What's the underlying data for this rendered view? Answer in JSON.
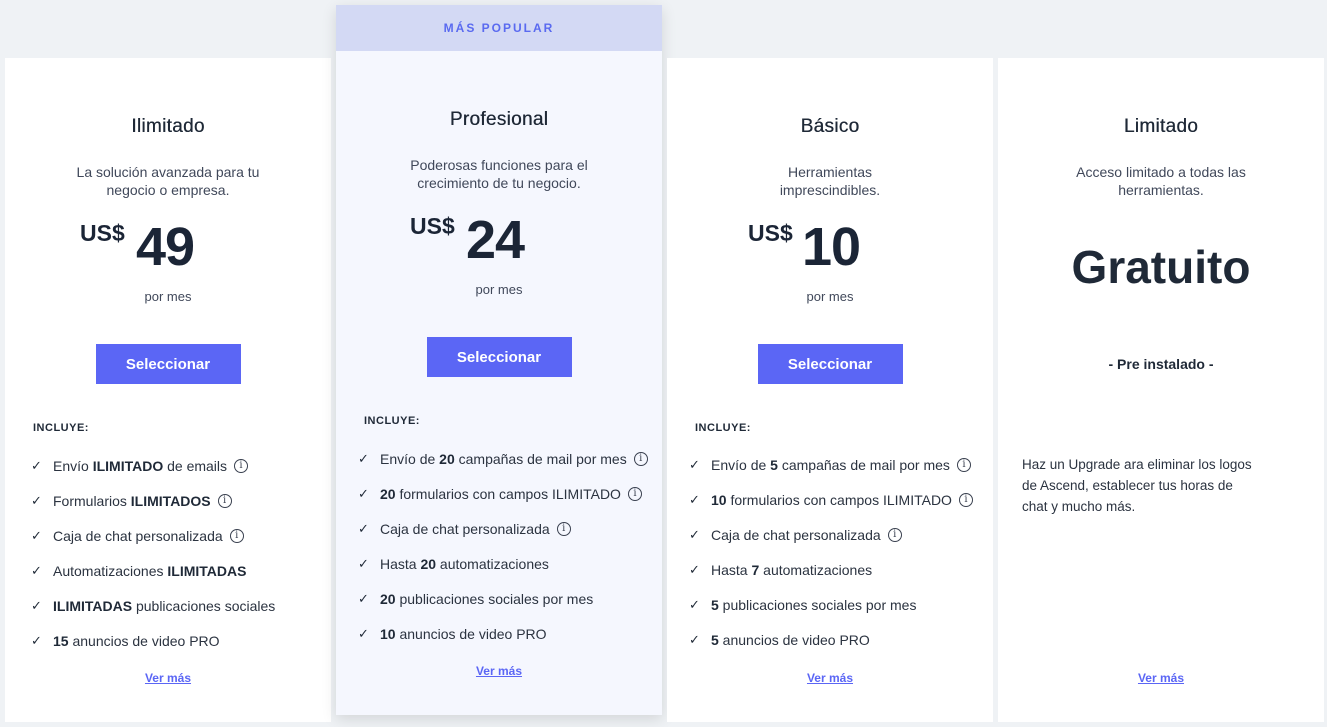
{
  "popular_banner": "MÁS POPULAR",
  "plans": [
    {
      "name": "Ilimitado",
      "description": "La solución avanzada para tu negocio o empresa.",
      "currency": "US$",
      "amount": "49",
      "period": "por mes",
      "button": "Seleccionar",
      "includes_label": "INCLUYE:",
      "features": [
        {
          "pre": "Envío ",
          "bold": "ILIMITADO",
          "post": " de emails",
          "info": true
        },
        {
          "pre": "Formularios ",
          "bold": "ILIMITADOS",
          "post": "",
          "info": true
        },
        {
          "pre": "Caja de chat personalizada",
          "bold": "",
          "post": "",
          "info": true
        },
        {
          "pre": "Automatizaciones ",
          "bold": "ILIMITADAS",
          "post": "",
          "info": false
        },
        {
          "pre": "",
          "bold": "ILIMITADAS",
          "post": " publicaciones sociales",
          "info": false
        },
        {
          "pre": "",
          "bold": "15",
          "post": " anuncios de video PRO",
          "info": false
        }
      ],
      "more": "Ver más"
    },
    {
      "name": "Profesional",
      "description": "Poderosas funciones para el crecimiento de tu negocio.",
      "currency": "US$",
      "amount": "24",
      "period": "por mes",
      "button": "Seleccionar",
      "includes_label": "INCLUYE:",
      "features": [
        {
          "pre": "Envío de ",
          "bold": "20",
          "post": " campañas de mail por mes",
          "info": true
        },
        {
          "pre": "",
          "bold": "20",
          "post": " formularios con campos ILIMITADO",
          "info": true
        },
        {
          "pre": "Caja de chat personalizada",
          "bold": "",
          "post": "",
          "info": true
        },
        {
          "pre": "Hasta ",
          "bold": "20",
          "post": " automatizaciones",
          "info": false
        },
        {
          "pre": "",
          "bold": "20",
          "post": " publicaciones sociales por mes",
          "info": false
        },
        {
          "pre": "",
          "bold": "10",
          "post": " anuncios de video PRO",
          "info": false
        }
      ],
      "more": "Ver más"
    },
    {
      "name": "Básico",
      "description": "Herramientas imprescindibles.",
      "currency": "US$",
      "amount": "10",
      "period": "por mes",
      "button": "Seleccionar",
      "includes_label": "INCLUYE:",
      "features": [
        {
          "pre": "Envío de ",
          "bold": "5",
          "post": " campañas de mail por mes",
          "info": true
        },
        {
          "pre": "",
          "bold": "10",
          "post": " formularios con campos ILIMITADO",
          "info": true
        },
        {
          "pre": "Caja de chat personalizada",
          "bold": "",
          "post": "",
          "info": true
        },
        {
          "pre": "Hasta ",
          "bold": "7",
          "post": " automatizaciones",
          "info": false
        },
        {
          "pre": "",
          "bold": "5",
          "post": " publicaciones sociales por mes",
          "info": false
        },
        {
          "pre": "",
          "bold": "5",
          "post": " anuncios de video PRO",
          "info": false
        }
      ],
      "more": "Ver más"
    },
    {
      "name": "Limitado",
      "description": "Acceso limitado a todas las herramientas.",
      "price_text": "Gratuito",
      "preinstalled": "- Pre instalado -",
      "note": "Haz un Upgrade ara eliminar los logos de Ascend, establecer tus horas de chat y mucho más.",
      "more": "Ver más"
    }
  ],
  "icons": {
    "check": "check-icon",
    "info": "info-icon"
  },
  "colors": {
    "accent": "#5b66f5",
    "banner_bg": "#d3d9f4",
    "banner_text": "#5a6af0"
  }
}
